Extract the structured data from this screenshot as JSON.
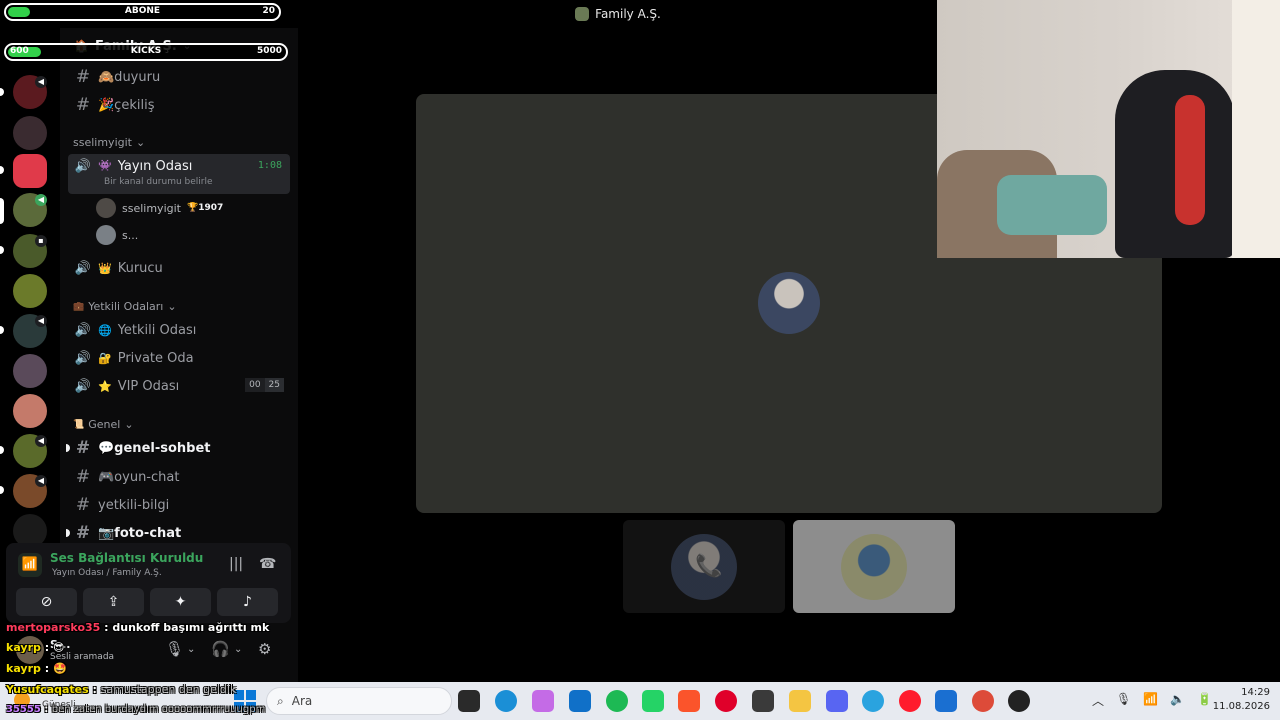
{
  "window": {
    "title": "Family A.Ş."
  },
  "server": {
    "name": "Family A.Ş.",
    "channels_top": [
      {
        "label": "🙈duyuru"
      },
      {
        "label": "🎉çekiliş"
      }
    ],
    "category_user": "sselimyigit",
    "voice_active": {
      "label": "Yayın Odası",
      "status": "Bir kanal durumu belirle",
      "timer": "1:08",
      "members": [
        {
          "name": "sselimyigit",
          "badge": "🏆1907"
        },
        {
          "name": "s..."
        }
      ]
    },
    "voice_kurucu": "Kurucu",
    "category_yetkili": "Yetkili Odaları",
    "voice_yetkili": "Yetkili Odası",
    "voice_private": "Private Oda",
    "voice_vip": {
      "label": "VIP Odası",
      "limit_current": "00",
      "limit_max": "25"
    },
    "category_genel": "Genel",
    "text_channels": [
      {
        "label": "💬genel-sohbet",
        "bold": true
      },
      {
        "label": "🎮oyun-chat",
        "bold": false
      },
      {
        "label": "yetkili-bilgi",
        "bold": false
      },
      {
        "label": "📷foto-chat",
        "bold": true
      }
    ]
  },
  "voice_panel": {
    "title": "Ses Bağlantısı Kuruldu",
    "subtitle": "Yayın Odası / Family A.Ş."
  },
  "user_panel": {
    "name": "S...",
    "status": "Sesli aramada"
  },
  "overlay": {
    "abone_label": "ABONE",
    "abone_value": "20",
    "abone_progress": 0.08,
    "kicks_label": "KICKS",
    "kicks_current": "600",
    "kicks_goal": "5000",
    "kicks_progress": 0.12
  },
  "chat": [
    {
      "user": "mertoparsko35",
      "sep": " : ",
      "msg": "dunkoff başımı ağrıttı mk",
      "color": "red"
    },
    {
      "user": "kayrp",
      "sep": " : ",
      "msg": "😎",
      "color": "yellow"
    },
    {
      "user": "kayrp",
      "sep": " : ",
      "msg": "🤩",
      "color": "yellow"
    },
    {
      "user": "Yusufcaqates",
      "sep": " : ",
      "msg": "samustappen den geldik",
      "color": "yellow"
    },
    {
      "user": "35555",
      "sep": " : ",
      "msg": "ben zaten burdaydım ooooommrrruuugpm",
      "color": "purple"
    }
  ],
  "taskbar": {
    "search_placeholder": "Ara",
    "weather": "Güneşli",
    "time": "14:29",
    "date": "11.08.2026"
  }
}
